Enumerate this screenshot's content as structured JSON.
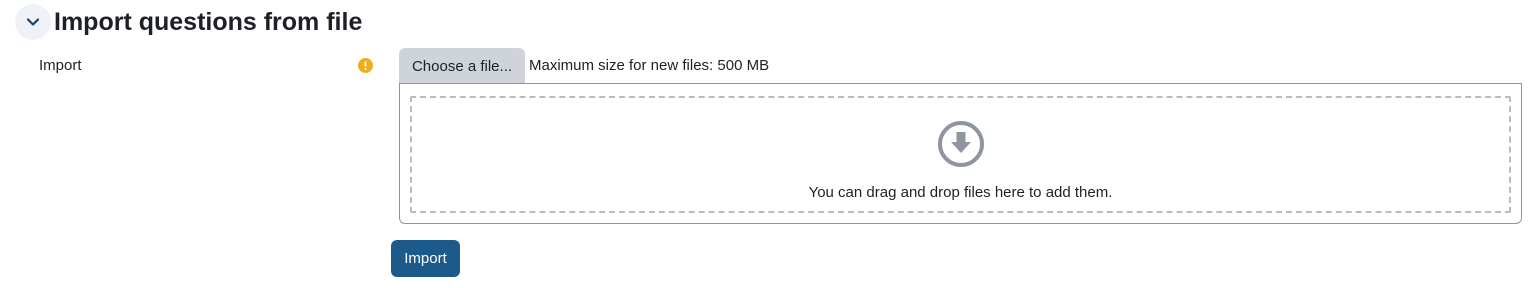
{
  "section": {
    "title": "Import questions from file",
    "toggle_icon": "chevron-down-icon"
  },
  "field": {
    "label": "Import",
    "required_icon": "exclamation-circle-icon",
    "choose_button_label": "Choose a file...",
    "max_size_text": "Maximum size for new files: 500 MB"
  },
  "dropzone": {
    "icon": "download-arrow-circle-icon",
    "message": "You can drag and drop files here to add them."
  },
  "actions": {
    "import_label": "Import"
  },
  "colors": {
    "primary_button": "#1d5a8c",
    "required_badge": "#f0ad1c",
    "secondary_button": "#ced4da"
  }
}
